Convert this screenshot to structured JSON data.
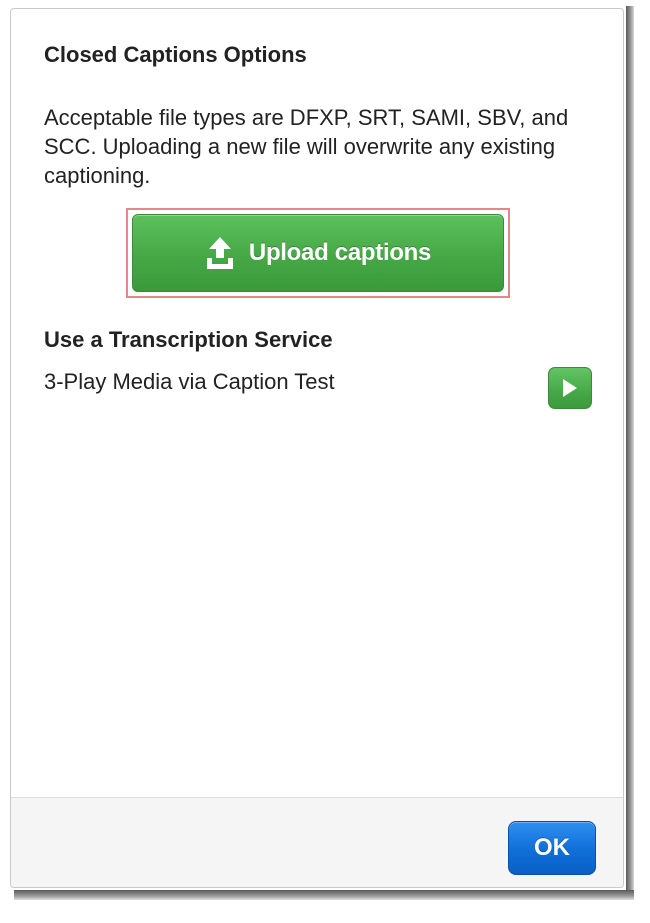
{
  "dialog": {
    "title": "Closed Captions Options",
    "description": "Acceptable file types are DFXP, SRT, SAMI, SBV, and SCC. Uploading a new file will overwrite any existing captioning.",
    "upload_button": {
      "label": "Upload captions",
      "icon": "upload-icon",
      "color": "#47a847"
    },
    "transcription": {
      "title": "Use a Transcription Service",
      "services": [
        {
          "name": "3-Play Media via Caption Test",
          "action_icon": "play-icon"
        }
      ]
    },
    "footer": {
      "ok_label": "OK",
      "ok_color": "#0f6fd8"
    },
    "highlight_color": "#e3888a"
  }
}
